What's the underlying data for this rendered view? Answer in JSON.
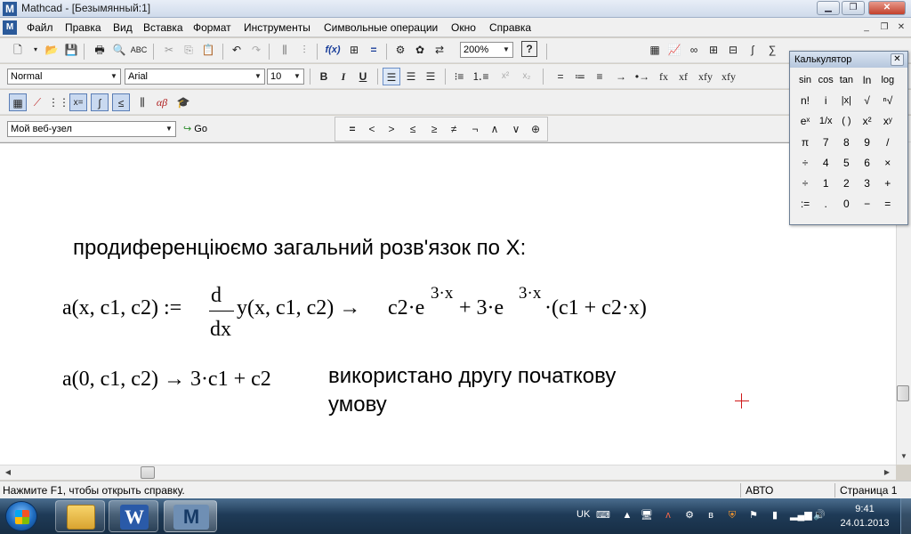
{
  "window": {
    "title": "Mathcad - [Безымянный:1]",
    "app_icon": "mathcad-logo-icon",
    "controls": [
      "minimize",
      "restore",
      "close"
    ]
  },
  "menu": {
    "items": [
      "Файл",
      "Правка",
      "Вид",
      "Вставка",
      "Формат",
      "Инструменты",
      "Символьные операции",
      "Окно",
      "Справка"
    ]
  },
  "toolbar_standard": {
    "zoom": "200%"
  },
  "toolbar_formatting": {
    "style": "Normal",
    "font": "Arial",
    "size": "10",
    "bold": "B",
    "italic": "I",
    "underline": "U"
  },
  "toolbar_math_extra": {
    "symbols": [
      "=",
      "≔",
      "≡",
      "→",
      "•→",
      "fx",
      "xf",
      "xfy",
      "xfy"
    ]
  },
  "toolbar_web": {
    "url": "Мой веб-узел",
    "go": "Go"
  },
  "toolbar_boolean": {
    "symbols": [
      "=",
      "<",
      ">",
      "≤",
      "≥",
      "≠",
      "¬",
      "∧",
      "∨",
      "⊕"
    ]
  },
  "worksheet": {
    "text1": "продиференціюємо загальний розв'язок по X:",
    "eq1": {
      "lhs": "a(x, c1, c2) :=",
      "d": "d",
      "dx": "dx",
      "expr": "y(x, c1, c2) →",
      "t1": "c2·e",
      "exp1": "3·x",
      "plus1": " + 3·e",
      "exp2": "3·x",
      "t2": "·(c1 + c2·x)"
    },
    "eq2": "a(0, c1, c2) → 3·c1 + c2",
    "text2_line1": "використано другу початкову",
    "text2_line2": "умову"
  },
  "status": {
    "help": "Нажмите F1, чтобы открыть справку.",
    "mode": "АВТО",
    "page": "Страница 1"
  },
  "calculator": {
    "title": "Калькулятор",
    "keys": [
      [
        "sin",
        "cos",
        "tan",
        "ln",
        "log"
      ],
      [
        "n!",
        "i",
        "|x|",
        "√",
        "ⁿ√"
      ],
      [
        "eˣ",
        "1/x",
        "( )",
        "x²",
        "xʸ"
      ],
      [
        "π",
        "7",
        "8",
        "9",
        "/"
      ],
      [
        "÷",
        "4",
        "5",
        "6",
        "×"
      ],
      [
        "÷",
        "1",
        "2",
        "3",
        "+"
      ],
      [
        ":=",
        ".",
        "0",
        "−",
        "="
      ]
    ]
  },
  "taskbar": {
    "lang": "UK",
    "time": "9:41",
    "date": "24.01.2013"
  }
}
